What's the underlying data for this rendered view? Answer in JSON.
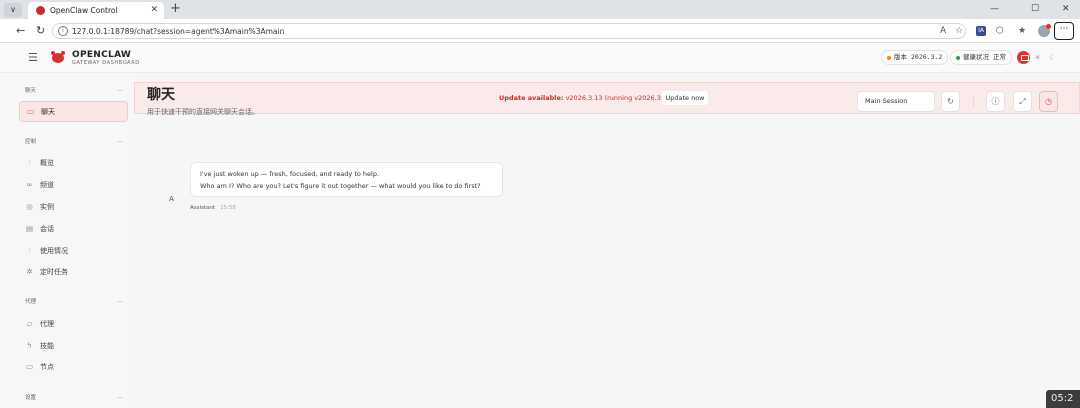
{
  "browser": {
    "tab_title": "OpenClaw Control",
    "tab_overflow_glyph": "∨",
    "tab_close_glyph": "✕",
    "new_tab_glyph": "+",
    "window": {
      "minimize": "—",
      "maximize": "☐",
      "close": "✕"
    },
    "nav": {
      "back": "←",
      "reload": "↻"
    },
    "url": "127.0.0.1:18789/chat?session=agent%3Amain%3Amain",
    "toolbar": {
      "translate": "A",
      "favorite": "☆",
      "ext_badge": "IA",
      "extensions": "⬡",
      "favorites": "★",
      "menu": "···"
    }
  },
  "header": {
    "brand": "OPENCLAW",
    "brand_sub": "GATEWAY DASHBOARD",
    "version_label": "版本",
    "version_value": "2026.3.2",
    "health_label": "健康状况",
    "health_value": "正常",
    "icons": [
      "chat-icon",
      "sun-icon",
      "moon-icon"
    ],
    "sun_glyph": "☀",
    "moon_glyph": "☾",
    "colors": {
      "accent": "#e03131",
      "version_dot": "#f08c00",
      "health_dot": "#2f9e44"
    }
  },
  "sidebar": {
    "sections": [
      {
        "title": "聊天",
        "items": [
          {
            "label": "聊天",
            "icon": "chat-icon",
            "active": true
          }
        ]
      },
      {
        "title": "控制",
        "items": [
          {
            "label": "概览",
            "icon": "bar-chart-icon"
          },
          {
            "label": "频道",
            "icon": "link-icon"
          },
          {
            "label": "实例",
            "icon": "radio-icon"
          },
          {
            "label": "会话",
            "icon": "document-icon"
          },
          {
            "label": "使用情况",
            "icon": "bar-chart-icon"
          },
          {
            "label": "定时任务",
            "icon": "loader-icon"
          }
        ]
      },
      {
        "title": "代理",
        "items": [
          {
            "label": "代理",
            "icon": "folder-icon"
          },
          {
            "label": "技能",
            "icon": "zap-icon"
          },
          {
            "label": "节点",
            "icon": "monitor-icon"
          }
        ]
      },
      {
        "title": "设置",
        "items": []
      }
    ]
  },
  "banner": {
    "label": "Update available:",
    "text": "v2026.3.13 (running v2026.3.2).",
    "button": "Update now"
  },
  "page": {
    "title": "聊天",
    "subtitle": "用于快速干预的直接网关聊天会话。"
  },
  "controls": {
    "session_select": "Main Session",
    "buttons": [
      "refresh-icon",
      "info-icon",
      "fullscreen-icon",
      "clock-icon"
    ],
    "refresh_glyph": "↻",
    "info_glyph": "ⓘ",
    "fullscreen_glyph": "⤢",
    "clock_glyph": "◷"
  },
  "messages": [
    {
      "avatar": "A",
      "lines": [
        "I've just woken up — fresh, focused, and ready to help.",
        "Who am I? Who are you? Let's figure it out together — what would you like to do first?"
      ],
      "sender": "Assistant",
      "time": "15:58"
    }
  ],
  "overlay_clock": "05:2"
}
